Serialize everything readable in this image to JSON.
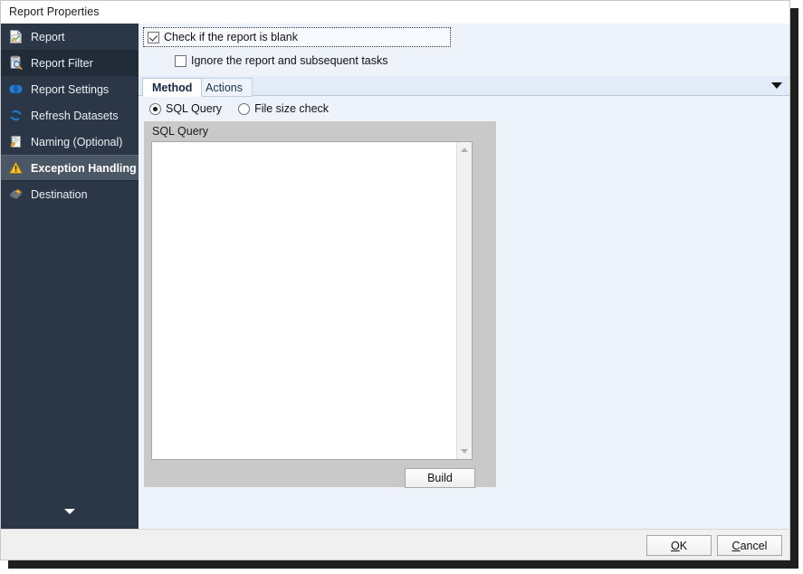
{
  "window": {
    "title": "Report Properties"
  },
  "sidebar": {
    "items": [
      {
        "label": "Report",
        "icon": "report-document-icon",
        "state": "normal"
      },
      {
        "label": "Report Filter",
        "icon": "report-filter-icon",
        "state": "dark"
      },
      {
        "label": "Report Settings",
        "icon": "report-settings-icon",
        "state": "normal"
      },
      {
        "label": "Refresh Datasets",
        "icon": "refresh-datasets-icon",
        "state": "normal"
      },
      {
        "label": "Naming (Optional)",
        "icon": "naming-icon",
        "state": "normal"
      },
      {
        "label": "Exception Handling",
        "icon": "warning-triangle-icon",
        "state": "selected"
      },
      {
        "label": "Destination",
        "icon": "destination-icon",
        "state": "normal"
      }
    ],
    "expander_icon": "chevron-down-icon"
  },
  "content": {
    "blank_check": {
      "label": "Check if the report is blank",
      "checked": true
    },
    "ignore_check": {
      "label": "Ignore the report and subsequent tasks",
      "checked": false
    },
    "tabs": [
      {
        "label": "Method",
        "active": true
      },
      {
        "label": "Actions",
        "active": false
      }
    ],
    "tab_overflow_icon": "chevron-down-icon",
    "method_options": [
      {
        "label": "SQL Query",
        "selected": true
      },
      {
        "label": "File size check",
        "selected": false
      }
    ],
    "sql_group": {
      "title": "SQL Query",
      "editor_value": "",
      "editor_placeholder": "",
      "build_label": "Build",
      "scroll_up_icon": "scroll-up-arrow-icon",
      "scroll_down_icon": "scroll-down-arrow-icon"
    }
  },
  "footer": {
    "ok": {
      "accel": "O",
      "rest": "K"
    },
    "cancel": {
      "accel": "C",
      "rest": "ancel"
    }
  },
  "colors": {
    "sidebar_bg": "#2b3746",
    "sidebar_selected": "#4c5766",
    "content_bg": "#eef3fb",
    "panel_gray": "#c9c9c9",
    "accent_warning": "#f0c419"
  }
}
